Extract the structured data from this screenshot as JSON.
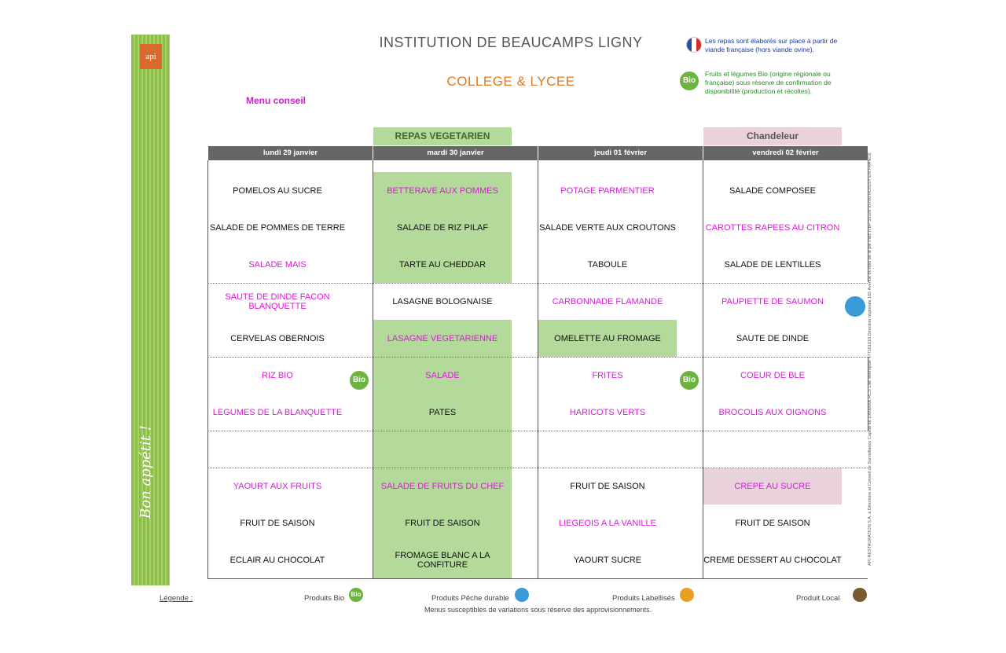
{
  "header": {
    "title": "INSTITUTION DE BEAUCAMPS LIGNY",
    "subtitle": "COLLEGE & LYCEE",
    "menu_type": "Menu conseil",
    "note_france": "Les repas sont élaborés sur place à partir de viande française (hors viande ovine).",
    "note_bio": "Fruits et légumes Bio (origine régionale ou française) sous réserve de confirmation de disponibilité (production et récoltes).",
    "bio_badge": "Bio"
  },
  "sidebar": {
    "logo": "api",
    "slogan": "Bon appétit !"
  },
  "themes": {
    "vegetarian": "REPAS VEGETARIEN",
    "chandeleur": "Chandeleur"
  },
  "days": [
    "lundi 29 janvier",
    "mardi 30 janvier",
    "jeudi 01 février",
    "vendredi 02 février"
  ],
  "menu": {
    "monday": [
      "POMELOS AU SUCRE",
      "SALADE DE POMMES DE TERRE",
      "SALADE MAIS",
      "SAUTE DE DINDE FACON BLANQUETTE",
      "CERVELAS OBERNOIS",
      "RIZ BIO",
      "LEGUMES DE LA BLANQUETTE",
      "YAOURT AUX FRUITS",
      "FRUIT DE SAISON",
      "ECLAIR AU CHOCOLAT"
    ],
    "tuesday": [
      "BETTERAVE AUX POMMES",
      "SALADE DE RIZ PILAF",
      "TARTE AU CHEDDAR",
      "LASAGNE BOLOGNAISE",
      "LASAGNE VEGETARIENNE",
      "SALADE",
      "PATES",
      "SALADE DE FRUITS DU CHEF",
      "FRUIT DE SAISON",
      "FROMAGE BLANC A LA CONFITURE"
    ],
    "thursday": [
      "POTAGE PARMENTIER",
      "SALADE VERTE AUX CROUTONS",
      "TABOULE",
      "CARBONNADE FLAMANDE",
      "OMELETTE AU FROMAGE",
      "FRITES",
      "HARICOTS VERTS",
      "FRUIT DE SAISON",
      "LIEGEOIS A LA VANILLE",
      "YAOURT SUCRE"
    ],
    "friday": [
      "SALADE COMPOSEE",
      "CAROTTES RAPEES AU CITRON",
      "SALADE DE LENTILLES",
      "PAUPIETTE DE SAUMON",
      "SAUTE DE DINDE",
      "COEUR DE BLE",
      "BROCOLIS AUX OIGNONS",
      "CREPE AU SUCRE",
      "FRUIT DE SAISON",
      "CREME DESSERT AU CHOCOLAT"
    ]
  },
  "legend": {
    "label": "Légende :",
    "bio": "Produits Bio",
    "peche": "Produits Pêche durable",
    "labellises": "Produits Labellisés",
    "local": "Produit Local",
    "footnote": "Menus susceptibles de variations sous réserve des approvisionnements."
  },
  "legal": "API RESTAURATION S.A. à Directoire et Conseil de Surveillance Capital de 1000000€ RCS Lille Métropole 477181010 Direction régionale 165 Avenue du bois de la pie Parc II BP 55109 95700 ROISSY EN FRANCE",
  "colors": {
    "highlight_green": "#b3d99b",
    "highlight_pink": "#ead2dc",
    "accent_magenta": "#d81ad8",
    "accent_orange": "#e07a20"
  }
}
